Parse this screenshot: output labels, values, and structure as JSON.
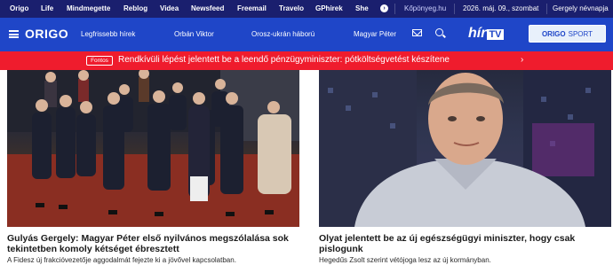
{
  "topbar": {
    "links": [
      "Origo",
      "Life",
      "Mindmegette",
      "Reblog",
      "Videa",
      "Newsfeed",
      "Freemail",
      "Travelo",
      "GPhirek",
      "She"
    ],
    "partner": "Kőpönyeg.hu",
    "date": "2026. máj. 09., szombat",
    "nameday": "Gergely névnapja"
  },
  "header": {
    "logo": "ORIGO",
    "nav": [
      "Legfrissebb hírek",
      "Orbán Viktor",
      "Orosz-ukrán háború",
      "Magyar Péter"
    ],
    "hirtv_main": "hír",
    "hirtv_tv": "TV",
    "sport_bold": "ORIGO",
    "sport_thin": "SPORT"
  },
  "breaking": {
    "badge": "Fontos",
    "text": "Rendkívüli lépést jelentett be a leendő pénzügyminiszter: pótköltségvetést készítene"
  },
  "articles": [
    {
      "title": "Gulyás Gergely: Magyar Péter első nyilvános megszólalása sok tekintetben komoly kétséget ébresztett",
      "lead": "A Fidesz új frakcióvezetője aggodalmát fejezte ki a jövővel kapcsolatban."
    },
    {
      "title": "Olyat jelentett be az új egészségügyi miniszter, hogy csak pislogunk",
      "lead": "Hegedűs Zsolt szerint vétójoga lesz az új kormányban."
    }
  ],
  "colors": {
    "topbar": "#1a1f6e",
    "header": "#1f46c8",
    "breaking": "#ef1c2d"
  }
}
